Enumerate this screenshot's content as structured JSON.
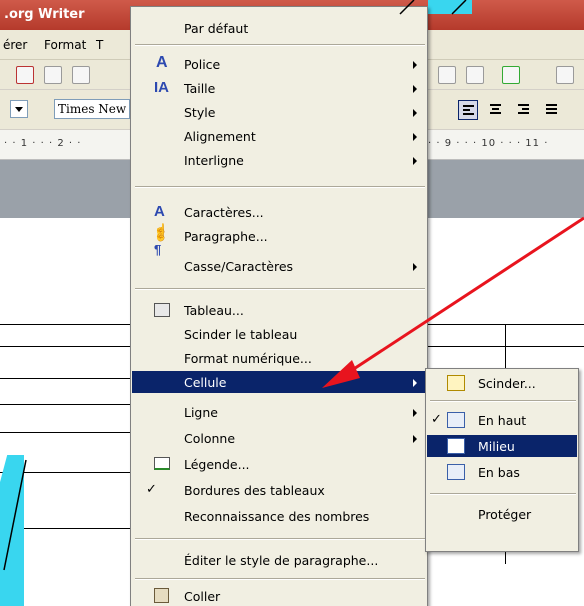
{
  "app": {
    "title": ".org Writer",
    "menus": [
      "érer",
      "Format",
      "T"
    ],
    "font_name": "Times New",
    "ruler_left": "· · 1 · · · 2 · ·",
    "ruler_right": "· · 9 · · · 10 · · · 11 ·"
  },
  "context_menu": {
    "items": [
      {
        "label": "Par défaut"
      },
      {
        "label": "Police",
        "icon": "font-icon",
        "submenu": true
      },
      {
        "label": "Taille",
        "icon": "font-size-icon",
        "submenu": true
      },
      {
        "label": "Style",
        "submenu": true
      },
      {
        "label": "Alignement",
        "submenu": true
      },
      {
        "label": "Interligne",
        "submenu": true
      },
      {
        "label": "Caractères...",
        "icon": "character-icon"
      },
      {
        "label": "Paragraphe...",
        "icon": "paragraph-icon"
      },
      {
        "label": "Casse/Caractères",
        "submenu": true
      },
      {
        "label": "Tableau...",
        "icon": "table-icon"
      },
      {
        "label": "Scinder le tableau"
      },
      {
        "label": "Format numérique..."
      },
      {
        "label": "Cellule",
        "submenu": true,
        "highlighted": true
      },
      {
        "label": "Ligne",
        "submenu": true
      },
      {
        "label": "Colonne",
        "submenu": true
      },
      {
        "label": "Légende...",
        "icon": "caption-icon"
      },
      {
        "label": "Bordures des tableaux",
        "checked": true
      },
      {
        "label": "Reconnaissance des nombres"
      },
      {
        "label": "Éditer le style de paragraphe..."
      },
      {
        "label": "Coller",
        "icon": "paste-icon"
      }
    ]
  },
  "cell_submenu": {
    "items": [
      {
        "label": "Scinder...",
        "icon": "split-cell-icon"
      },
      {
        "label": "En haut",
        "icon": "align-top-icon",
        "checked": true
      },
      {
        "label": "Milieu",
        "icon": "align-middle-icon",
        "highlighted": true
      },
      {
        "label": "En bas",
        "icon": "align-bottom-icon"
      },
      {
        "label": "Protéger"
      }
    ]
  },
  "colors": {
    "highlight": "#0a246a",
    "menu_bg": "#f1efe2",
    "annotation_red": "#e8141e",
    "annotation_cyan": "#39d6ef"
  }
}
